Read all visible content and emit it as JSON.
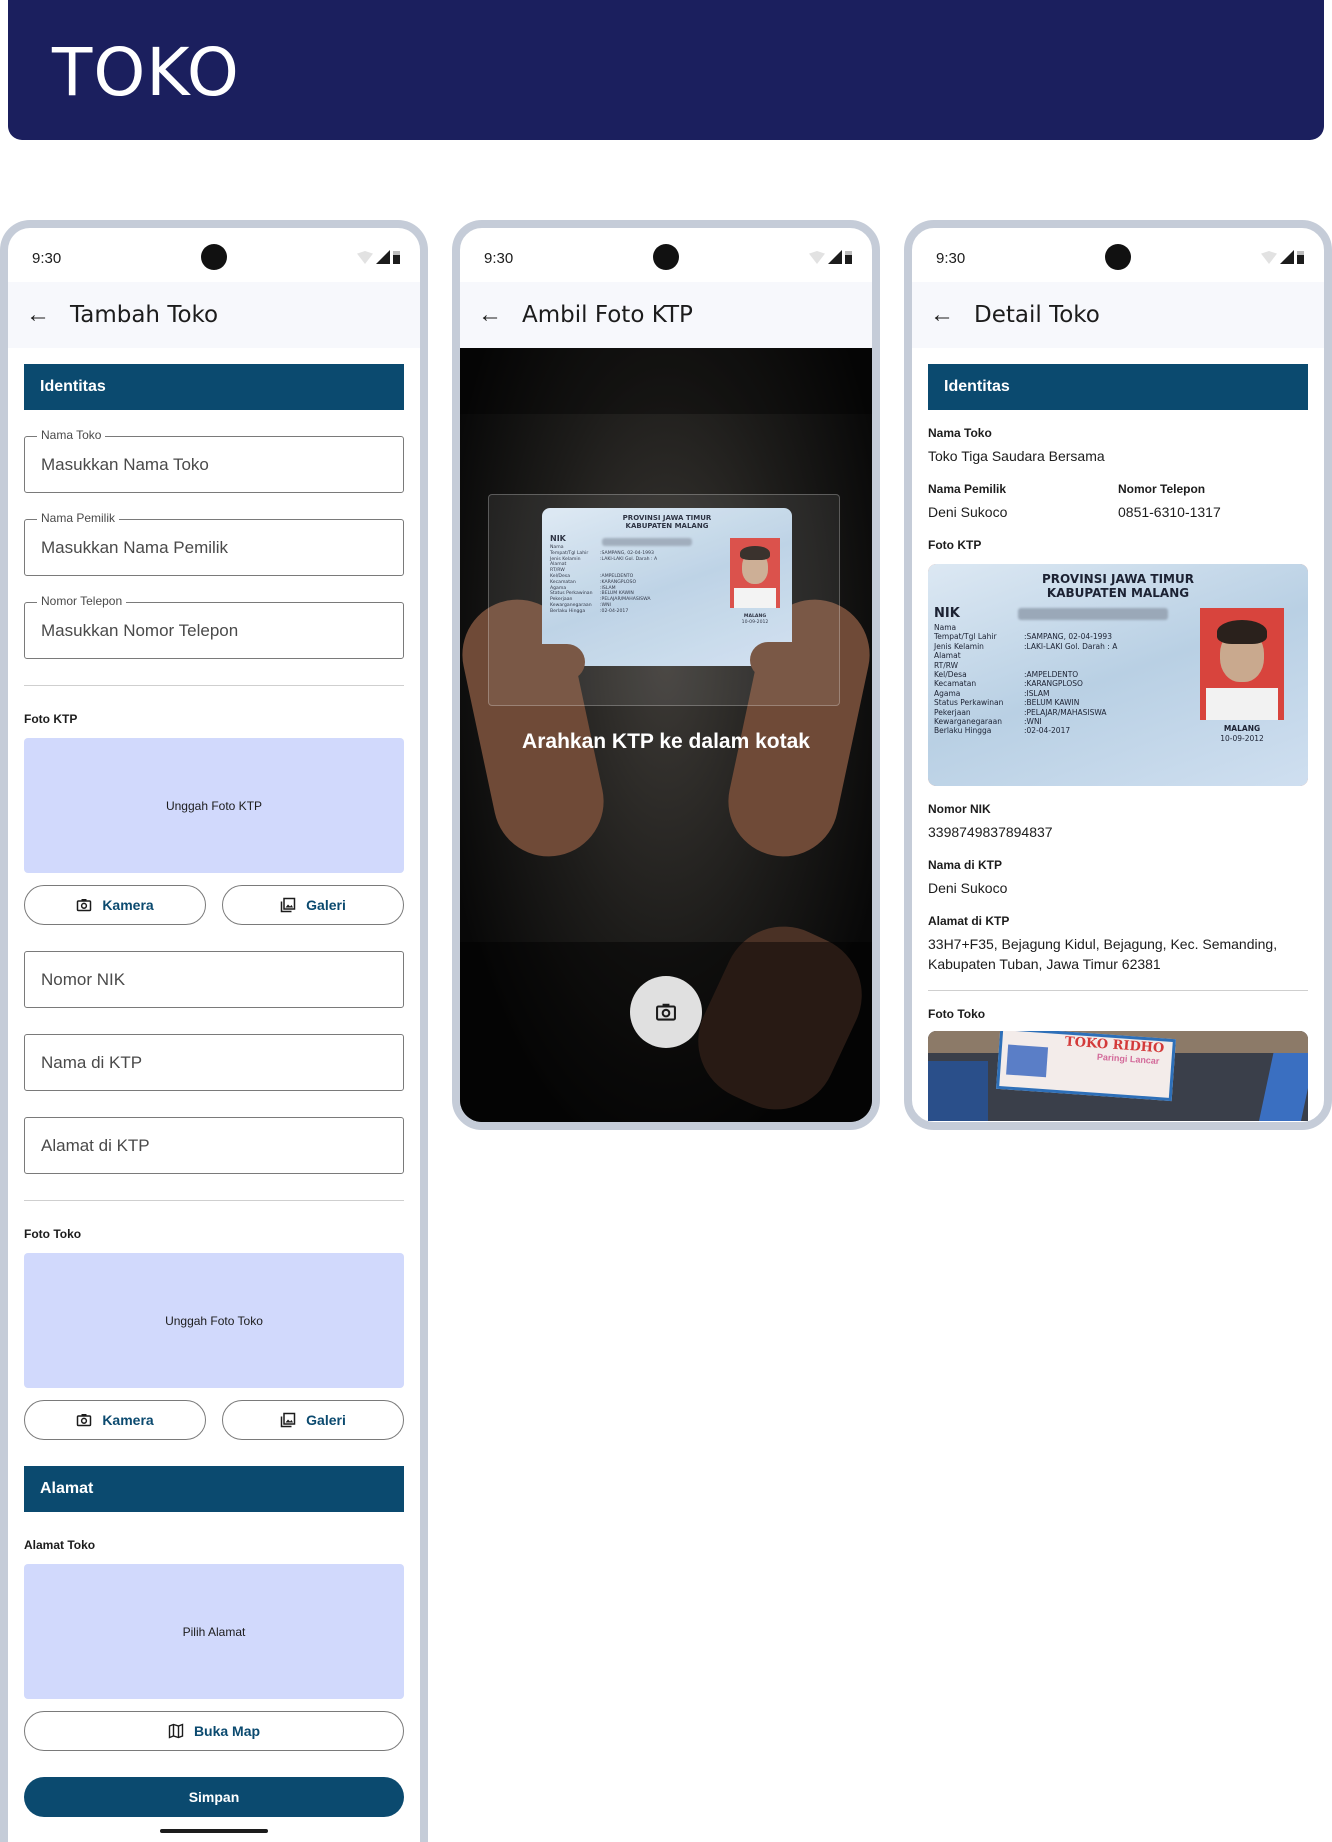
{
  "banner": {
    "title": "TOKO"
  },
  "status": {
    "time": "9:30"
  },
  "screen1": {
    "title": "Tambah Toko",
    "section_identitas": "Identitas",
    "nama_toko": {
      "label": "Nama Toko",
      "placeholder": "Masukkan Nama Toko"
    },
    "nama_pemilik": {
      "label": "Nama Pemilik",
      "placeholder": "Masukkan Nama Pemilik"
    },
    "nomor_telepon": {
      "label": "Nomor Telepon",
      "placeholder": "Masukkan Nomor Telepon"
    },
    "foto_ktp_label": "Foto KTP",
    "upload_ktp": "Unggah Foto KTP",
    "btn_kamera": "Kamera",
    "btn_galeri": "Galeri",
    "nomor_nik": "Nomor NIK",
    "nama_ktp": "Nama di KTP",
    "alamat_ktp": "Alamat di KTP",
    "foto_toko_label": "Foto Toko",
    "upload_toko": "Unggah Foto Toko",
    "section_alamat": "Alamat",
    "alamat_toko_label": "Alamat Toko",
    "pilih_alamat": "Pilih Alamat",
    "btn_map": "Buka Map",
    "btn_simpan": "Simpan"
  },
  "screen2": {
    "title": "Ambil Foto KTP",
    "hint": "Arahkan KTP ke dalam kotak"
  },
  "screen3": {
    "title": "Detail Toko",
    "section_identitas": "Identitas",
    "nama_toko_label": "Nama Toko",
    "nama_toko_value": "Toko Tiga Saudara Bersama",
    "nama_pemilik_label": "Nama Pemilik",
    "nama_pemilik_value": "Deni Sukoco",
    "nomor_telepon_label": "Nomor Telepon",
    "nomor_telepon_value": "0851-6310-1317",
    "foto_ktp_label": "Foto KTP",
    "nomor_nik_label": "Nomor NIK",
    "nomor_nik_value": "3398749837894837",
    "nama_ktp_label": "Nama di KTP",
    "nama_ktp_value": "Deni Sukoco",
    "alamat_ktp_label": "Alamat di KTP",
    "alamat_ktp_value": "33H7+F35, Bejagung Kidul, Bejagung, Kec. Semanding, Kabupaten Tuban, Jawa Timur 62381",
    "foto_toko_label": "Foto Toko"
  },
  "ktp_card": {
    "province": "PROVINSI JAWA TIMUR",
    "regency": "KABUPATEN MALANG",
    "nik": "NIK",
    "rows": [
      [
        "Nama",
        ""
      ],
      [
        "Tempat/Tgl Lahir",
        ":SAMPANG, 02-04-1993"
      ],
      [
        "Jenis Kelamin",
        ":LAKI-LAKI     Gol. Darah : A"
      ],
      [
        "Alamat",
        ""
      ],
      [
        "RT/RW",
        ""
      ],
      [
        "Kel/Desa",
        ":AMPELDENTO"
      ],
      [
        "Kecamatan",
        ":KARANGPLOSO"
      ],
      [
        "Agama",
        ":ISLAM"
      ],
      [
        "Status Perkawinan",
        ":BELUM KAWIN"
      ],
      [
        "Pekerjaan",
        ":PELAJAR/MAHASISWA"
      ],
      [
        "Kewarganegaraan",
        ":WNI"
      ],
      [
        "Berlaku Hingga",
        ":02-04-2017"
      ]
    ],
    "issued_place": "MALANG",
    "issued_date": "10-09-2012"
  },
  "shop_sign": {
    "name": "TOKO RIDHO",
    "subtitle": "Paringi Lancar"
  }
}
